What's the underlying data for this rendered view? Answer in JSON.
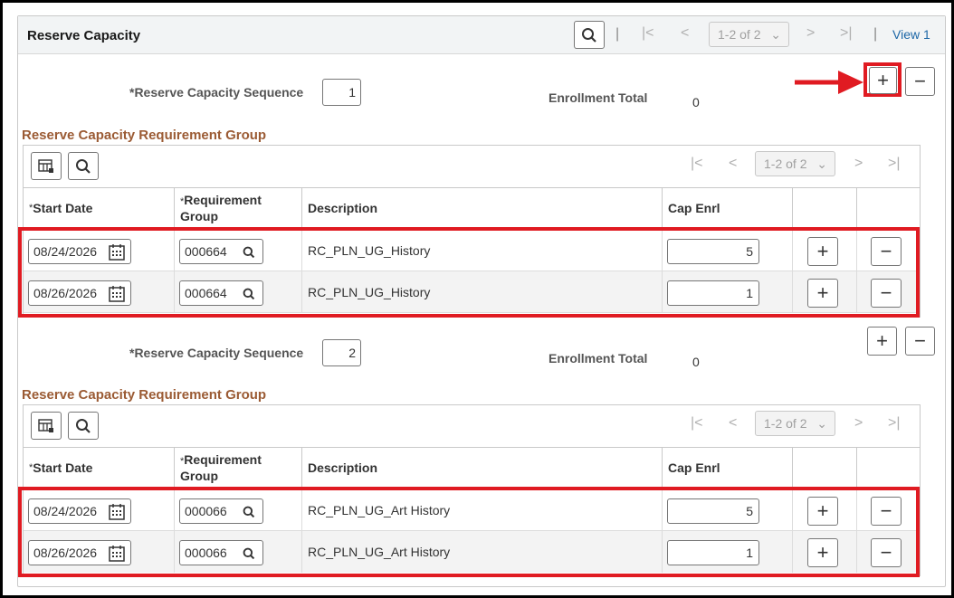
{
  "panel": {
    "title": "Reserve Capacity",
    "pager": "1-2 of 2",
    "view_link": "View 1"
  },
  "sequences": [
    {
      "seq_label": "*Reserve Capacity Sequence",
      "seq_value": "1",
      "enroll_label": "Enrollment Total",
      "enroll_value": "0",
      "group_title": "Reserve Capacity Requirement Group",
      "pager": "1-2 of 2",
      "columns": {
        "start": "Start Date",
        "group_a": "Requirement",
        "group_b": "Group",
        "desc": "Description",
        "cap": "Cap Enrl"
      },
      "rows": [
        {
          "date": "08/24/2026",
          "group": "000664",
          "desc": "RC_PLN_UG_History",
          "cap": "5"
        },
        {
          "date": "08/26/2026",
          "group": "000664",
          "desc": "RC_PLN_UG_History",
          "cap": "1"
        }
      ]
    },
    {
      "seq_label": "*Reserve Capacity Sequence",
      "seq_value": "2",
      "enroll_label": "Enrollment Total",
      "enroll_value": "0",
      "group_title": "Reserve Capacity Requirement Group",
      "pager": "1-2 of 2",
      "columns": {
        "start": "Start Date",
        "group_a": "Requirement",
        "group_b": "Group",
        "desc": "Description",
        "cap": "Cap Enrl"
      },
      "rows": [
        {
          "date": "08/24/2026",
          "group": "000066",
          "desc": "RC_PLN_UG_Art History",
          "cap": "5"
        },
        {
          "date": "08/26/2026",
          "group": "000066",
          "desc": "RC_PLN_UG_Art History",
          "cap": "1"
        }
      ]
    }
  ],
  "glyphs": {
    "plus": "+",
    "minus": "−",
    "first": "|<",
    "prev": "<",
    "next": ">",
    "last": ">|",
    "sep": "|",
    "chevron": "⌄",
    "required": "*"
  },
  "colors": {
    "annotation_red": "#e01b22",
    "section_title": "#9b5b34",
    "link": "#1c66a6"
  }
}
